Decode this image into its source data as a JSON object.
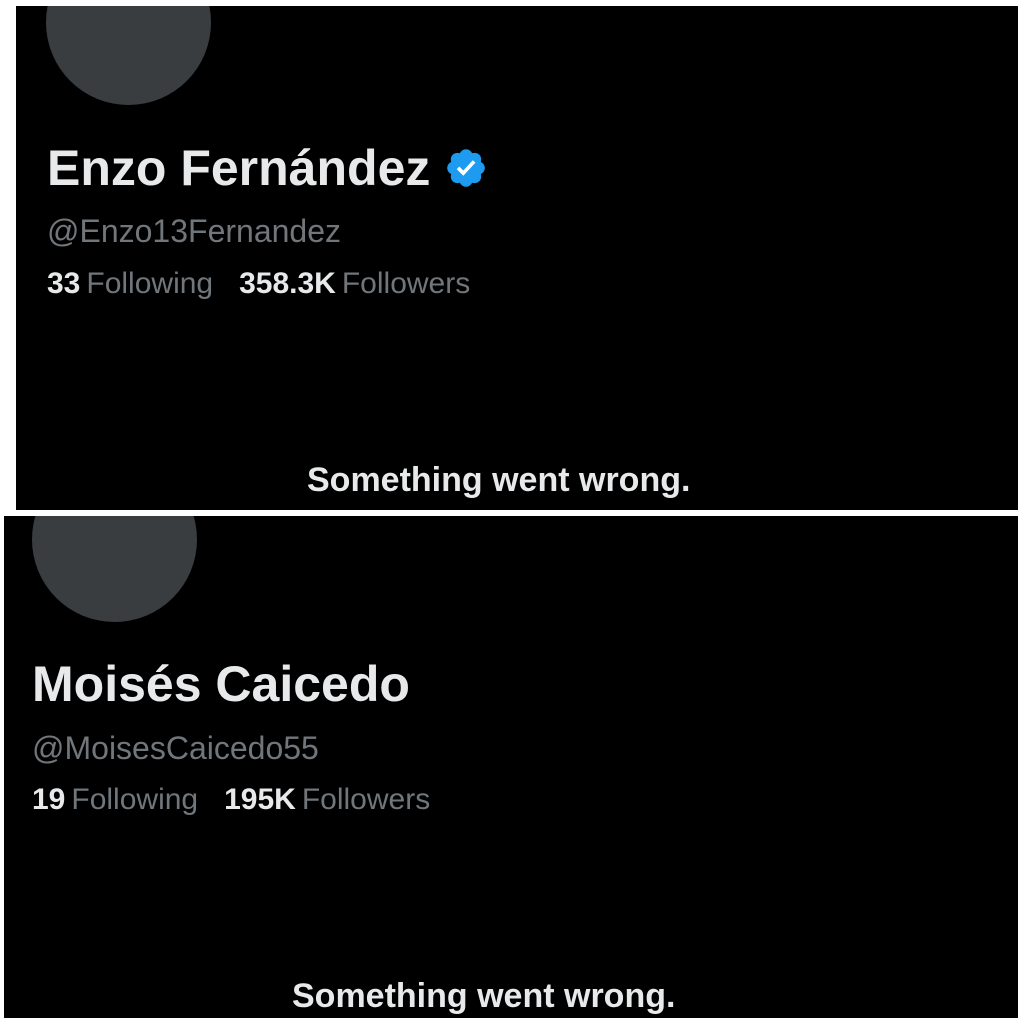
{
  "profiles": [
    {
      "display_name": "Enzo Fernández",
      "verified": true,
      "verified_color": "#1d9bf0",
      "badge_icon": "verified-badge-icon",
      "handle": "@Enzo13Fernandez",
      "following_count": "33",
      "following_label": "Following",
      "followers_count": "358.3K",
      "followers_label": "Followers",
      "error_message": "Something went wrong."
    },
    {
      "display_name": "Moisés Caicedo",
      "verified": false,
      "handle": "@MoisesCaicedo55",
      "following_count": "19",
      "following_label": "Following",
      "followers_count": "195K",
      "followers_label": "Followers",
      "error_message": "Something went wrong."
    }
  ],
  "colors": {
    "background": "#000000",
    "primary_text": "#e7e9ea",
    "secondary_text": "#71767b",
    "avatar_placeholder": "#3a3d40"
  }
}
